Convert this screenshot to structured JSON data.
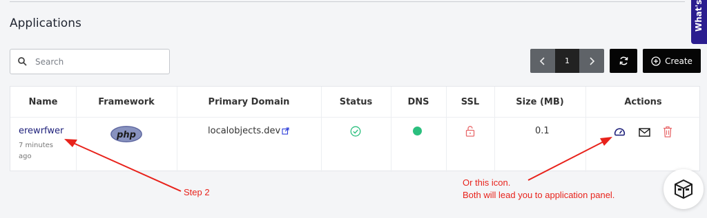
{
  "page": {
    "title": "Applications"
  },
  "feedback_tab": {
    "label": "What's"
  },
  "search": {
    "placeholder": "Search",
    "value": ""
  },
  "pagination": {
    "current_page": "1",
    "prev_icon": "chevron-left-icon",
    "next_icon": "chevron-right-icon"
  },
  "toolbar": {
    "refresh_icon": "refresh-icon",
    "create_label": "Create",
    "create_icon": "plus-circle-icon"
  },
  "table": {
    "columns": [
      "Name",
      "Framework",
      "Primary Domain",
      "Status",
      "DNS",
      "SSL",
      "Size (MB)",
      "Actions"
    ],
    "rows": [
      {
        "name": "erewrfwer",
        "created": "7 minutes ago",
        "framework": "php",
        "primary_domain": "localobjects.dev",
        "status": "active",
        "dns": "connected",
        "ssl": "unlocked",
        "size_mb": "0.1",
        "actions": [
          "dashboard-icon",
          "mail-icon",
          "trash-icon"
        ]
      }
    ]
  },
  "annotations": {
    "step2": "Step 2",
    "icon_note_line1": "Or this icon.",
    "icon_note_line2": "Both will lead you to application panel."
  },
  "colors": {
    "accent": "#1d1f7a",
    "status_green": "#2bbf7e",
    "ssl_red": "#e8686a",
    "annotation_red": "#e8221b",
    "button_dark": "#050505",
    "feedback_tab": "#2b1d8f"
  }
}
